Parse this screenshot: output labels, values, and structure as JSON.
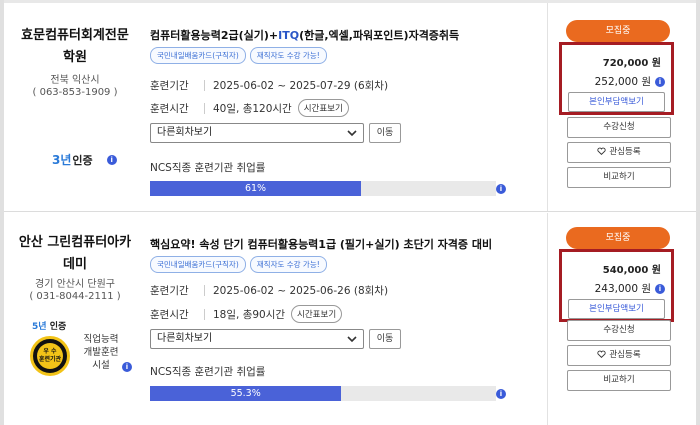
{
  "courses": [
    {
      "org_name_line1": "효문컴퓨터회계전문",
      "org_name_line2": "학원",
      "region": "전북 익산시",
      "phone": "( 063-853-1909 )",
      "cert_years": "3년",
      "cert_label": "인증",
      "title_prefix": "컴퓨터활용능력2급(실기)+",
      "title_highlight": "ITQ",
      "title_suffix": "(한글,엑셀,파워포인트)자격증취득",
      "tags": [
        "국민내일배움카드(구직자)",
        "재직자도 수강 가능!"
      ],
      "period_label": "훈련기간",
      "period_value": "2025-06-02 ~ 2025-07-29 (6회차)",
      "hours_label": "훈련시간",
      "hours_value": "40일, 총120시간",
      "timetable_label": "시간표보기",
      "select_value": "다른회차보기",
      "go_label": "이동",
      "rate_label": "NCS직종 훈련기관 취업률",
      "rate_value": 61,
      "rate_text": "61%",
      "badge": "모집중",
      "price": "720,000 원",
      "self_pay": "252,000 원",
      "self_pay_btn": "본인부담액보기",
      "apply_btn": "수강신청",
      "wish_btn": "관심등록",
      "compare_btn": "비교하기"
    },
    {
      "org_name_line1": "안산 그린컴퓨터아카",
      "org_name_line2": "데미",
      "region": "경기 안산시 단원구",
      "phone": "( 031-8044-2111 )",
      "cert_years": "5년",
      "cert_label": "인증",
      "seal_text_1": "우 수",
      "seal_text_2": "훈련기관",
      "seal_label_1": "직업능력",
      "seal_label_2": "개발훈련",
      "seal_label_3": "시설",
      "title_prefix": "핵심요약! 속성 단기 컴퓨터활용능력1급 (필기+실기) 초단기 자격증 대비",
      "tags": [
        "국민내일배움카드(구직자)",
        "재직자도 수강 가능!"
      ],
      "period_label": "훈련기간",
      "period_value": "2025-06-02 ~ 2025-06-26 (8회차)",
      "hours_label": "훈련시간",
      "hours_value": "18일, 총90시간",
      "timetable_label": "시간표보기",
      "select_value": "다른회차보기",
      "go_label": "이동",
      "rate_label": "NCS직종 훈련기관 취업률",
      "rate_value": 55.3,
      "rate_text": "55.3%",
      "badge": "모집중",
      "price": "540,000 원",
      "self_pay": "243,000 원",
      "self_pay_btn": "본인부담액보기",
      "apply_btn": "수강신청",
      "wish_btn": "관심등록",
      "compare_btn": "비교하기"
    }
  ],
  "icons": {
    "info": "info-icon",
    "select_arrow": "chevron-down-icon",
    "heart": "heart-icon"
  },
  "colors": {
    "accent_orange": "#ea6a1f",
    "highlight_red": "#a51c23",
    "progress_blue": "#4a62d8",
    "tag_blue": "#3b6fd4"
  }
}
